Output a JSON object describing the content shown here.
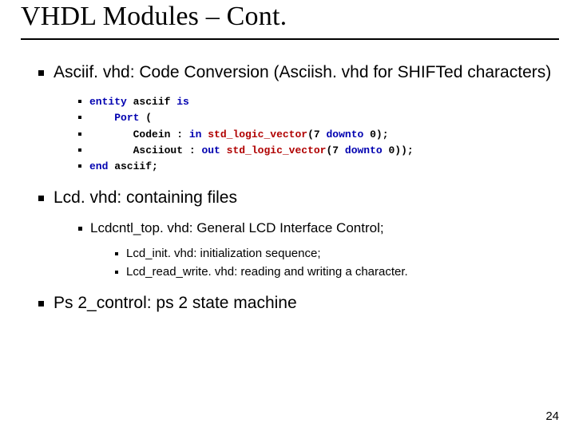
{
  "title": "VHDL Modules – Cont.",
  "sections": [
    {
      "heading": "Asciif. vhd: Code Conversion (Asciish. vhd for SHIFTed characters)",
      "code": [
        {
          "parts": [
            {
              "t": "entity",
              "c": "kw"
            },
            {
              "t": " asciif ",
              "c": ""
            },
            {
              "t": "is",
              "c": "kw"
            }
          ]
        },
        {
          "indent": 4,
          "parts": [
            {
              "t": "Port",
              "c": "kw"
            },
            {
              "t": " (",
              "c": ""
            }
          ]
        },
        {
          "indent": 7,
          "parts": [
            {
              "t": "Codein : ",
              "c": ""
            },
            {
              "t": "in",
              "c": "kw"
            },
            {
              "t": " ",
              "c": ""
            },
            {
              "t": "std_logic_vector",
              "c": "type"
            },
            {
              "t": "(7 ",
              "c": ""
            },
            {
              "t": "downto",
              "c": "kw"
            },
            {
              "t": " 0);",
              "c": ""
            }
          ]
        },
        {
          "indent": 7,
          "parts": [
            {
              "t": "Asciiout : ",
              "c": ""
            },
            {
              "t": "out",
              "c": "kw"
            },
            {
              "t": " ",
              "c": ""
            },
            {
              "t": "std_logic_vector",
              "c": "type"
            },
            {
              "t": "(7 ",
              "c": ""
            },
            {
              "t": "downto",
              "c": "kw"
            },
            {
              "t": " 0));",
              "c": ""
            }
          ]
        },
        {
          "parts": [
            {
              "t": "end",
              "c": "kw"
            },
            {
              "t": " asciif;",
              "c": ""
            }
          ]
        }
      ]
    },
    {
      "heading": "Lcd. vhd: containing files",
      "children": [
        {
          "text": "Lcdcntl_top. vhd: General LCD Interface Control;",
          "children": [
            {
              "text": "Lcd_init. vhd: initialization sequence;"
            },
            {
              "text": "Lcd_read_write. vhd: reading and writing a character."
            }
          ]
        }
      ]
    },
    {
      "heading": "Ps 2_control: ps 2 state machine"
    }
  ],
  "slide_number": "24"
}
